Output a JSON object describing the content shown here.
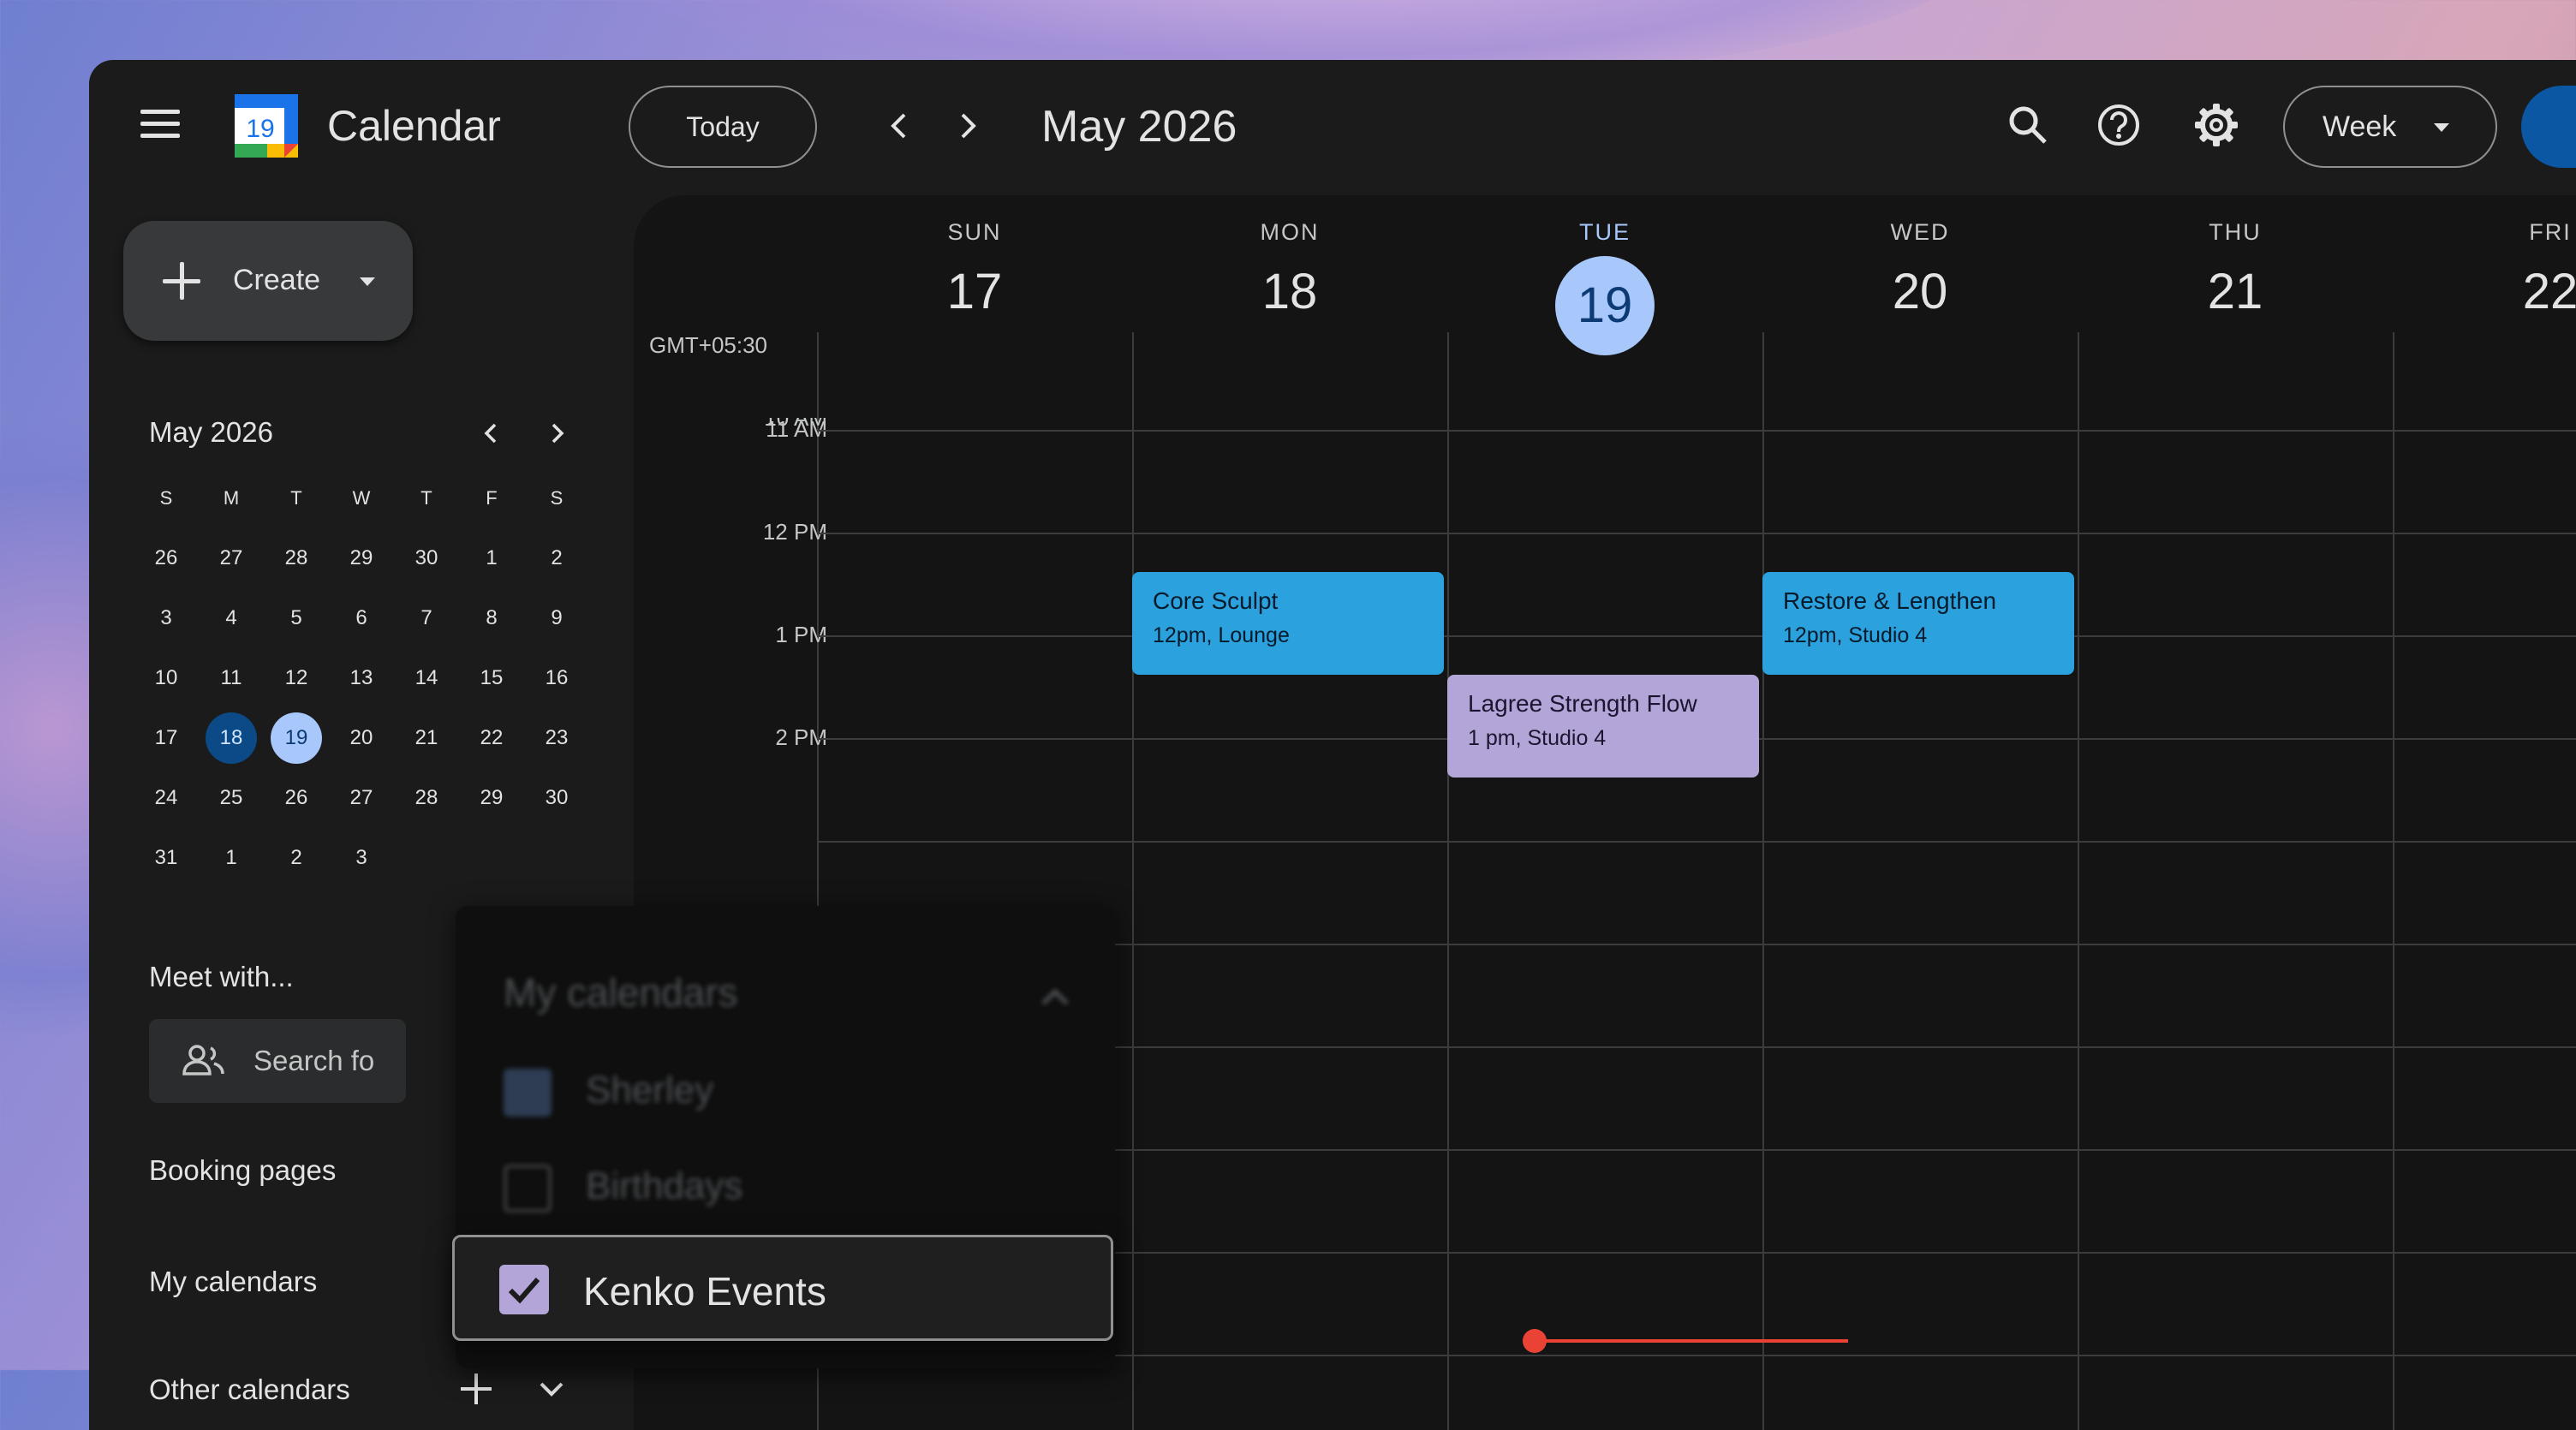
{
  "header": {
    "app_title": "Calendar",
    "logo_day": "19",
    "today_label": "Today",
    "period_title": "May 2026",
    "view_label": "Week"
  },
  "sidebar": {
    "create_label": "Create",
    "mini_calendar": {
      "title": "May 2026",
      "weekdays": [
        "S",
        "M",
        "T",
        "W",
        "T",
        "F",
        "S"
      ],
      "weeks": [
        [
          "26",
          "27",
          "28",
          "29",
          "30",
          "1",
          "2"
        ],
        [
          "3",
          "4",
          "5",
          "6",
          "7",
          "8",
          "9"
        ],
        [
          "10",
          "11",
          "12",
          "13",
          "14",
          "15",
          "16"
        ],
        [
          "17",
          "18",
          "19",
          "20",
          "21",
          "22",
          "23"
        ],
        [
          "24",
          "25",
          "26",
          "27",
          "28",
          "29",
          "30"
        ],
        [
          "31",
          "1",
          "2",
          "3",
          "",
          "",
          ""
        ]
      ],
      "selected": "18",
      "today": "19"
    },
    "meet_with_title": "Meet with...",
    "search_people_placeholder": "Search fo",
    "booking_pages": "Booking pages",
    "my_calendars": "My calendars",
    "other_calendars": "Other calendars"
  },
  "week": {
    "timezone": "GMT+05:30",
    "days": [
      {
        "dow": "SUN",
        "num": "17"
      },
      {
        "dow": "MON",
        "num": "18"
      },
      {
        "dow": "TUE",
        "num": "19",
        "current": true
      },
      {
        "dow": "WED",
        "num": "20"
      },
      {
        "dow": "THU",
        "num": "21"
      },
      {
        "dow": "FRI",
        "num": "22"
      }
    ],
    "hours": [
      "10 AM",
      "11 AM",
      "12 PM",
      "1 PM",
      "2 PM"
    ],
    "events": [
      {
        "title": "Core Sculpt",
        "sub": "12pm, Lounge",
        "color": "#2ba1dd"
      },
      {
        "title": "Lagree Strength Flow",
        "sub": "1 pm, Studio 4",
        "color": "#b3a5d7"
      },
      {
        "title": "Restore & Lengthen",
        "sub": "12pm, Studio 4",
        "color": "#2ba1dd"
      }
    ]
  },
  "drag_preview": {
    "title": "My calendars",
    "items": [
      {
        "label": "Sherley",
        "checked": true
      },
      {
        "label": "Birthdays",
        "checked": false
      }
    ],
    "dragged_item": {
      "label": "Kenko Events",
      "checked": true,
      "color": "#b3a5d7"
    }
  },
  "colors": {
    "today_highlight": "#a8c7fa",
    "selected_day": "#0b4a87",
    "current_time": "#ea4335"
  }
}
